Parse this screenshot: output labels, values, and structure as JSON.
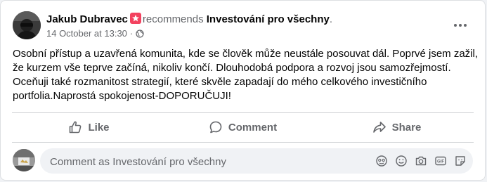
{
  "post": {
    "author": "Jakub Dubravec",
    "verb": "recommends",
    "page_name": "Investování pro všechny",
    "trailing_dot": ".",
    "timestamp": "14 October at 13:30",
    "separator": "·",
    "privacy_icon": "globe-icon",
    "badge_icon": "recommendation-star-icon",
    "more_icon": "more-horizontal-icon",
    "text": "Osobní přístup a uzavřená komunita, kde se člověk může neustále posouvat dál. Poprvé jsem zažil, že kurzem vše teprve začíná, nikoliv končí. Dlouhodobá podpora a rozvoj jsou samozřejmostí. Oceňuji také rozmanitost strategií, které skvěle zapadají do mého celkového investičního portfolia.Naprostá spokojenost-DOPORUČUJI!"
  },
  "actions": {
    "like": "Like",
    "comment": "Comment",
    "share": "Share"
  },
  "comment_box": {
    "placeholder": "Comment as Investování pro všechny",
    "tools": [
      "avatar-sticker-icon",
      "emoji-icon",
      "camera-icon",
      "gif-icon",
      "sticker-icon"
    ]
  },
  "colors": {
    "accent_badge": "#f3425f",
    "secondary_text": "#65676b",
    "input_bg": "#f0f2f5"
  }
}
